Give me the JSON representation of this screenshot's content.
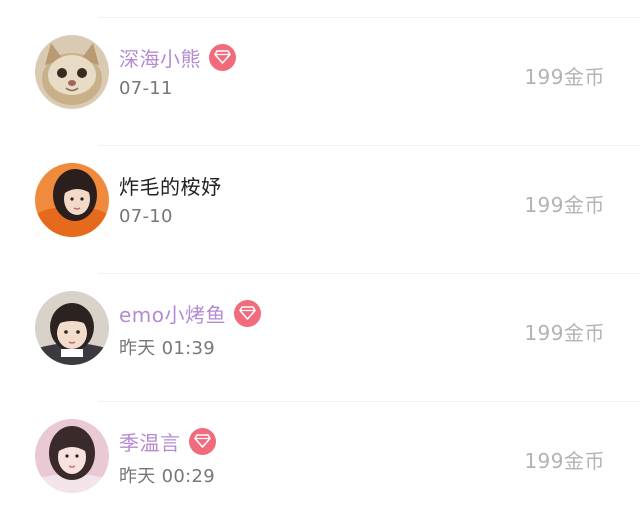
{
  "records": [
    {
      "name": "深海小熊",
      "vip": true,
      "date": "07-11",
      "price": "199金币",
      "avatar": "cat-avatar"
    },
    {
      "name": "炸毛的桉妤",
      "vip": false,
      "date": "07-10",
      "price": "199金币",
      "avatar": "girl-orange-avatar"
    },
    {
      "name": "emo小烤鱼",
      "vip": true,
      "date": "昨天 01:39",
      "price": "199金币",
      "avatar": "child-avatar"
    },
    {
      "name": "季温言",
      "vip": true,
      "date": "昨天 00:29",
      "price": "199金币",
      "avatar": "girl-pink-avatar"
    }
  ],
  "colors": {
    "vip_name": "#b48ad3",
    "vip_badge": "#f26b7d",
    "name": "#222222",
    "date": "#777777",
    "price": "#b3b3b3"
  },
  "icons": {
    "vip": "diamond-icon"
  }
}
